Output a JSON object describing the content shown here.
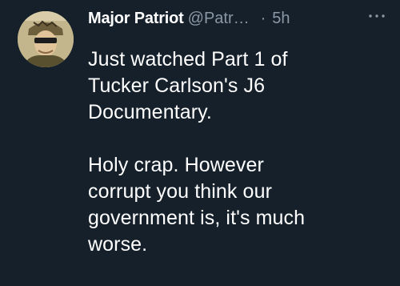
{
  "tweet": {
    "display_name": "Major Patriot",
    "handle": "@Patr…",
    "separator": "·",
    "timestamp": "5h",
    "more_icon": "more-horizontal-icon",
    "avatar_icon": "profile-photo",
    "body": {
      "paragraph_1": {
        "line_1": "Just watched Part 1 of",
        "line_2": "Tucker Carlson's J6",
        "line_3": "Documentary."
      },
      "paragraph_2": {
        "line_1": "Holy crap. However",
        "line_2": "corrupt you think our",
        "line_3": "government is, it's much",
        "line_4": "worse."
      }
    }
  },
  "colors": {
    "background": "#15202b",
    "primary_text": "#ffffff",
    "secondary_text": "#8b98a5"
  }
}
